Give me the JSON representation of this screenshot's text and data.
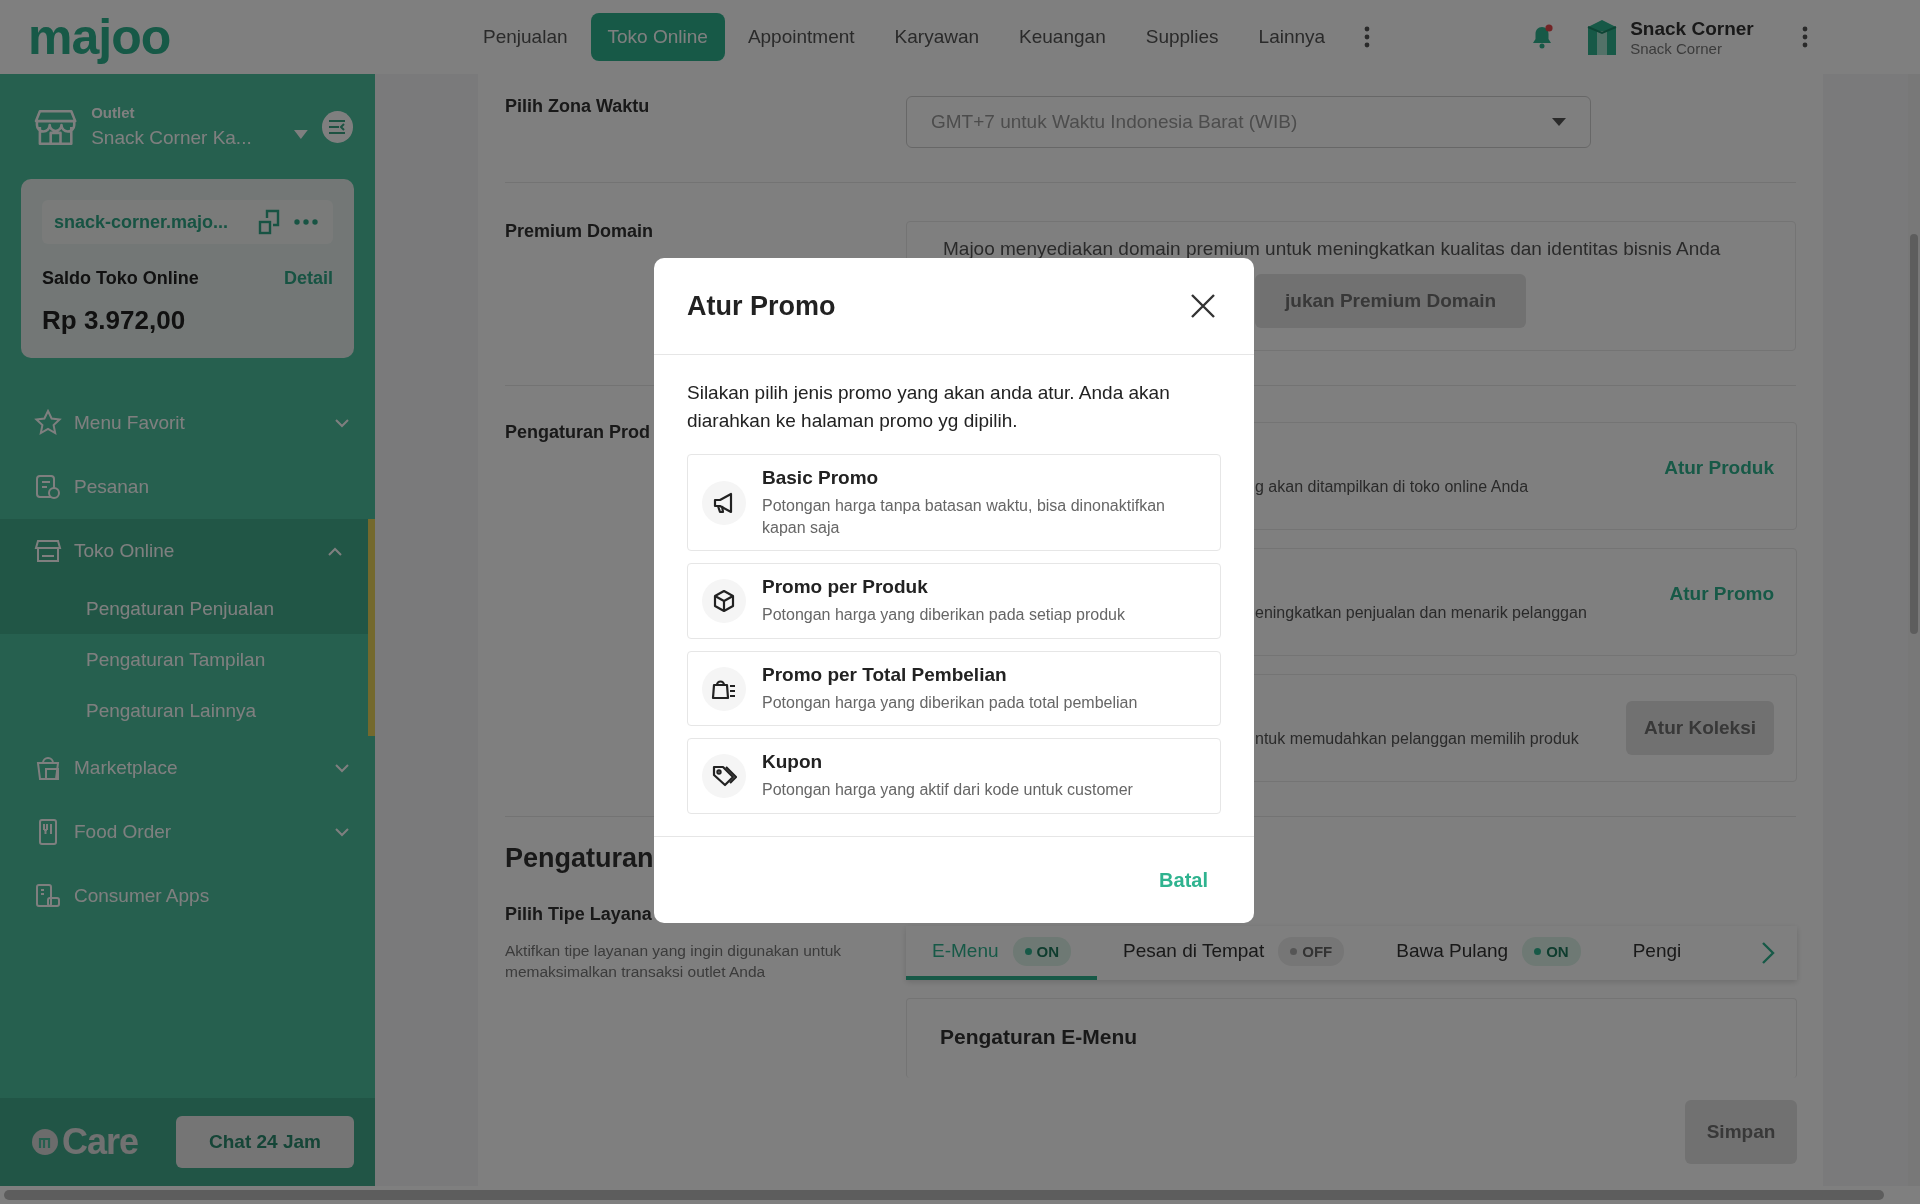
{
  "header": {
    "brand": "majoo",
    "nav": [
      {
        "label": "Penjualan",
        "selected": false
      },
      {
        "label": "Toko Online",
        "selected": true
      },
      {
        "label": "Appointment",
        "selected": false
      },
      {
        "label": "Karyawan",
        "selected": false
      },
      {
        "label": "Keuangan",
        "selected": false
      },
      {
        "label": "Supplies",
        "selected": false
      },
      {
        "label": "Lainnya",
        "selected": false
      }
    ],
    "notification": {
      "unread": true
    },
    "user": {
      "name": "Snack Corner",
      "subtitle": "Snack Corner"
    }
  },
  "sidebar": {
    "outlet": {
      "label": "Outlet",
      "value": "Snack Corner Ka..."
    },
    "store_card": {
      "url": "snack-corner.majo...",
      "balance_label": "Saldo Toko Online",
      "detail_link": "Detail",
      "balance": "Rp 3.972,00"
    },
    "items": [
      {
        "label": "Menu Favorit",
        "kind": "group",
        "expanded": false
      },
      {
        "label": "Pesanan",
        "kind": "link"
      },
      {
        "label": "Toko Online",
        "kind": "group",
        "expanded": true,
        "children": [
          {
            "label": "Pengaturan Penjualan",
            "selected": true
          },
          {
            "label": "Pengaturan Tampilan",
            "selected": false
          },
          {
            "label": "Pengaturan Lainnya",
            "selected": false
          }
        ]
      },
      {
        "label": "Marketplace",
        "kind": "group",
        "expanded": false
      },
      {
        "label": "Food Order",
        "kind": "group",
        "expanded": false
      },
      {
        "label": "Consumer Apps",
        "kind": "link"
      }
    ],
    "care": {
      "brand": "Care",
      "button": "Chat 24 Jam"
    }
  },
  "main": {
    "timezone": {
      "label": "Pilih Zona Waktu",
      "value": "GMT+7 untuk Waktu Indonesia Barat (WIB)"
    },
    "premium_domain": {
      "label": "Premium Domain",
      "text": "Majoo menyediakan domain premium untuk meningkatkan kualitas dan identitas bisnis Anda",
      "button": "jukan Premium Domain"
    },
    "product_settings": {
      "label": "Pengaturan Prod",
      "cards": [
        {
          "text": "g akan ditampilkan di toko online Anda",
          "action": "Atur Produk",
          "kind": "link"
        },
        {
          "text": "eningkatkan penjualan dan menarik pelanggan",
          "action": "Atur Promo",
          "kind": "link"
        },
        {
          "text": "ntuk memudahkan pelanggan memilih produk",
          "action": "Atur Koleksi",
          "kind": "button"
        }
      ]
    },
    "service": {
      "heading": "Pengaturan",
      "label": "Pilih Tipe Layana",
      "description": "Aktifkan tipe layanan yang ingin digunakan untuk memaksimalkan transaksi outlet Anda",
      "tabs": [
        {
          "label": "E-Menu",
          "status": "ON",
          "on": true,
          "selected": true
        },
        {
          "label": "Pesan di Tempat",
          "status": "OFF",
          "on": false,
          "selected": false
        },
        {
          "label": "Bawa Pulang",
          "status": "ON",
          "on": true,
          "selected": false
        },
        {
          "label": "Pengi",
          "selected": false
        }
      ],
      "panel_title": "Pengaturan E-Menu"
    },
    "save_button": "Simpan"
  },
  "modal": {
    "title": "Atur Promo",
    "intro": "Silakan pilih jenis promo yang akan anda atur. Anda akan diarahkan ke halaman promo yg dipilih.",
    "options": [
      {
        "title": "Basic Promo",
        "description": "Potongan harga tanpa batasan waktu, bisa dinonaktifkan kapan saja"
      },
      {
        "title": "Promo per Produk",
        "description": "Potongan harga yang diberikan pada setiap produk"
      },
      {
        "title": "Promo per Total Pembelian",
        "description": "Potongan harga yang diberikan pada total pembelian"
      },
      {
        "title": "Kupon",
        "description": "Potongan harga yang aktif dari kode untuk customer"
      }
    ],
    "cancel": "Batal"
  }
}
